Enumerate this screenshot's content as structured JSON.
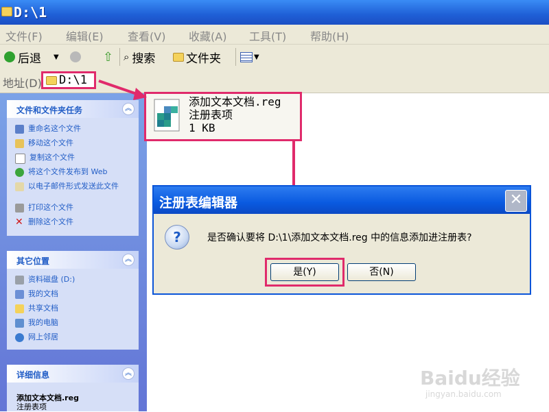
{
  "window": {
    "title": "D:\\1"
  },
  "menu": [
    "文件(F)",
    "编辑(E)",
    "查看(V)",
    "收藏(A)",
    "工具(T)",
    "帮助(H)"
  ],
  "toolbar": {
    "back": "后退",
    "search": "搜索",
    "folders": "文件夹"
  },
  "address": {
    "label": "地址(D)",
    "value": "D:\\1"
  },
  "tasks_panel": {
    "title": "文件和文件夹任务",
    "items": [
      "重命名这个文件",
      "移动这个文件",
      "复制这个文件",
      "将这个文件发布到 Web",
      "以电子邮件形式发送此文件",
      "打印这个文件",
      "删除这个文件"
    ]
  },
  "places_panel": {
    "title": "其它位置",
    "items": [
      "资料磁盘 (D:)",
      "我的文档",
      "共享文档",
      "我的电脑",
      "网上邻居"
    ]
  },
  "details_panel": {
    "title": "详细信息",
    "name": "添加文本文档.reg",
    "type": "注册表项"
  },
  "file": {
    "name": "添加文本文档.reg",
    "type": "注册表项",
    "size": "1 KB"
  },
  "dialog": {
    "title": "注册表编辑器",
    "message": "是否确认要将 D:\\1\\添加文本文档.reg 中的信息添加进注册表?",
    "yes": "是(Y)",
    "no": "否(N)"
  },
  "watermark": {
    "brand": "Baidu经验",
    "url": "jingyan.baidu.com"
  },
  "colors": {
    "highlight": "#e02a6b",
    "xp_blue": "#0a54d8",
    "panel_bg": "#d6dff7"
  }
}
